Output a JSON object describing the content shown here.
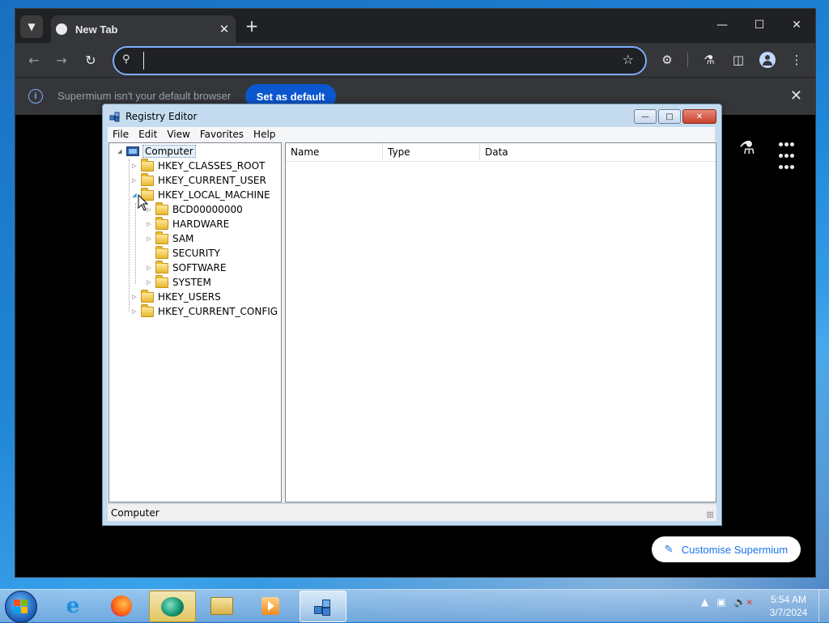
{
  "browser": {
    "tab": {
      "title": "New Tab"
    },
    "omnibox": {
      "value": "",
      "placeholder": ""
    },
    "infobar": {
      "message": "Supermium isn't your default browser",
      "set_default_label": "Set as default"
    },
    "customise_label": "Customise Supermium"
  },
  "regedit": {
    "title": "Registry Editor",
    "menu": [
      "File",
      "Edit",
      "View",
      "Favorites",
      "Help"
    ],
    "tree": {
      "root": "Computer",
      "hives": [
        "HKEY_CLASSES_ROOT",
        "HKEY_CURRENT_USER",
        "HKEY_LOCAL_MACHINE",
        "HKEY_USERS",
        "HKEY_CURRENT_CONFIG"
      ],
      "hklm_children": [
        "BCD00000000",
        "HARDWARE",
        "SAM",
        "SECURITY",
        "SOFTWARE",
        "SYSTEM"
      ]
    },
    "columns": [
      "Name",
      "Type",
      "Data"
    ],
    "status": "Computer"
  },
  "taskbar": {
    "clock_time": "5:54 AM",
    "clock_date": "3/7/2024"
  }
}
